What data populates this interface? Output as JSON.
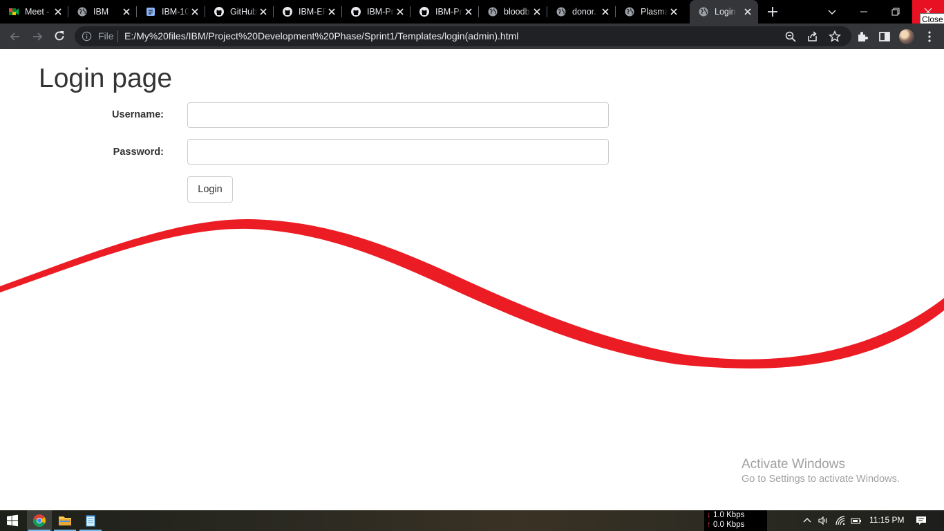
{
  "browser": {
    "tabs": [
      {
        "title": "Meet - ",
        "icon": "google-meet-icon",
        "active": false
      },
      {
        "title": "IBM",
        "icon": "globe-icon",
        "active": false
      },
      {
        "title": "IBM-10",
        "icon": "doc-icon",
        "active": false
      },
      {
        "title": "GitHub",
        "icon": "github-icon",
        "active": false
      },
      {
        "title": "IBM-EP",
        "icon": "github-icon",
        "active": false
      },
      {
        "title": "IBM-Pr",
        "icon": "github-icon",
        "active": false
      },
      {
        "title": "IBM-Pr",
        "icon": "github-icon",
        "active": false
      },
      {
        "title": "bloodb",
        "icon": "globe-icon",
        "active": false
      },
      {
        "title": "donor.",
        "icon": "globe-icon",
        "active": false
      },
      {
        "title": "Plasma",
        "icon": "globe-icon",
        "active": false
      },
      {
        "title": "Login",
        "icon": "globe-icon",
        "active": true
      }
    ],
    "close_tooltip": "Close",
    "address": {
      "scheme_label": "File",
      "url": "E:/My%20files/IBM/Project%20Development%20Phase/Sprint1/Templates/login(admin).html"
    }
  },
  "page": {
    "title": "Login page",
    "username_label": "Username:",
    "password_label": "Password:",
    "username_value": "",
    "password_value": "",
    "login_button": "Login",
    "wave_color": "#ec1c24"
  },
  "watermark": {
    "title": "Activate Windows",
    "subtitle": "Go to Settings to activate Windows."
  },
  "taskbar": {
    "apps": [
      "windows-start-icon",
      "chrome-icon",
      "file-explorer-icon",
      "notepad-icon"
    ],
    "net_down": "1.0 Kbps",
    "net_up": "0.0 Kbps",
    "time": "11:15 PM"
  }
}
